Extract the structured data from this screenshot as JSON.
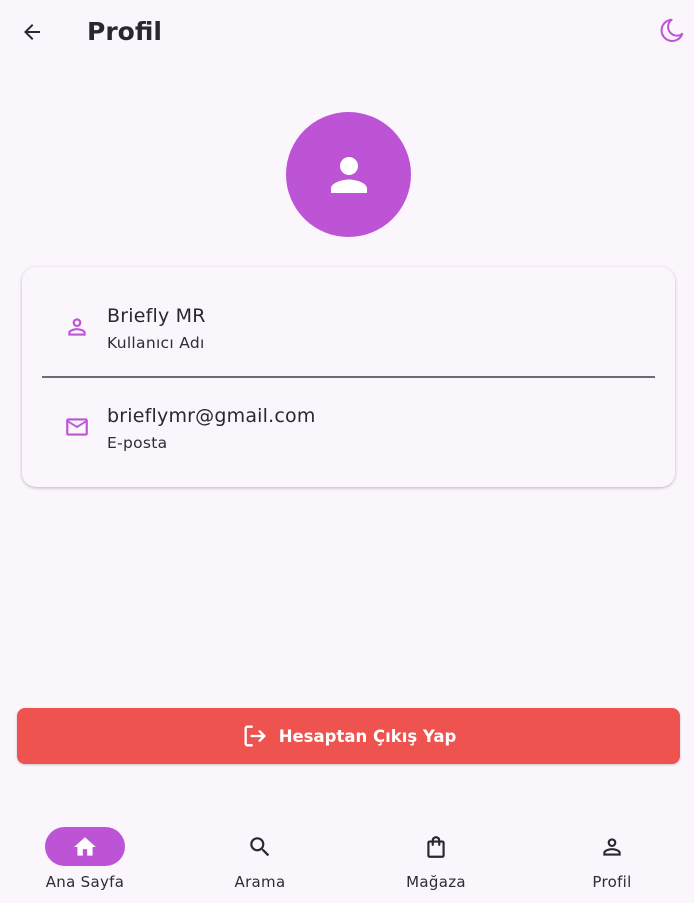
{
  "appbar": {
    "title": "Profil"
  },
  "profile": {
    "username": "Briefly MR",
    "username_label": "Kullanıcı Adı",
    "email": "brieflymr@gmail.com",
    "email_label": "E-posta"
  },
  "logout": {
    "label": "Hesaptan Çıkış Yap"
  },
  "nav": [
    {
      "label": "Ana Sayfa",
      "icon": "home-icon",
      "active": true
    },
    {
      "label": "Arama",
      "icon": "search-icon",
      "active": false
    },
    {
      "label": "Mağaza",
      "icon": "shopping-bag-icon",
      "active": false
    },
    {
      "label": "Profil",
      "icon": "person-icon",
      "active": false
    }
  ],
  "colors": {
    "accent": "#bd54d6",
    "danger": "#ee534f",
    "background": "#fbf5fc"
  }
}
